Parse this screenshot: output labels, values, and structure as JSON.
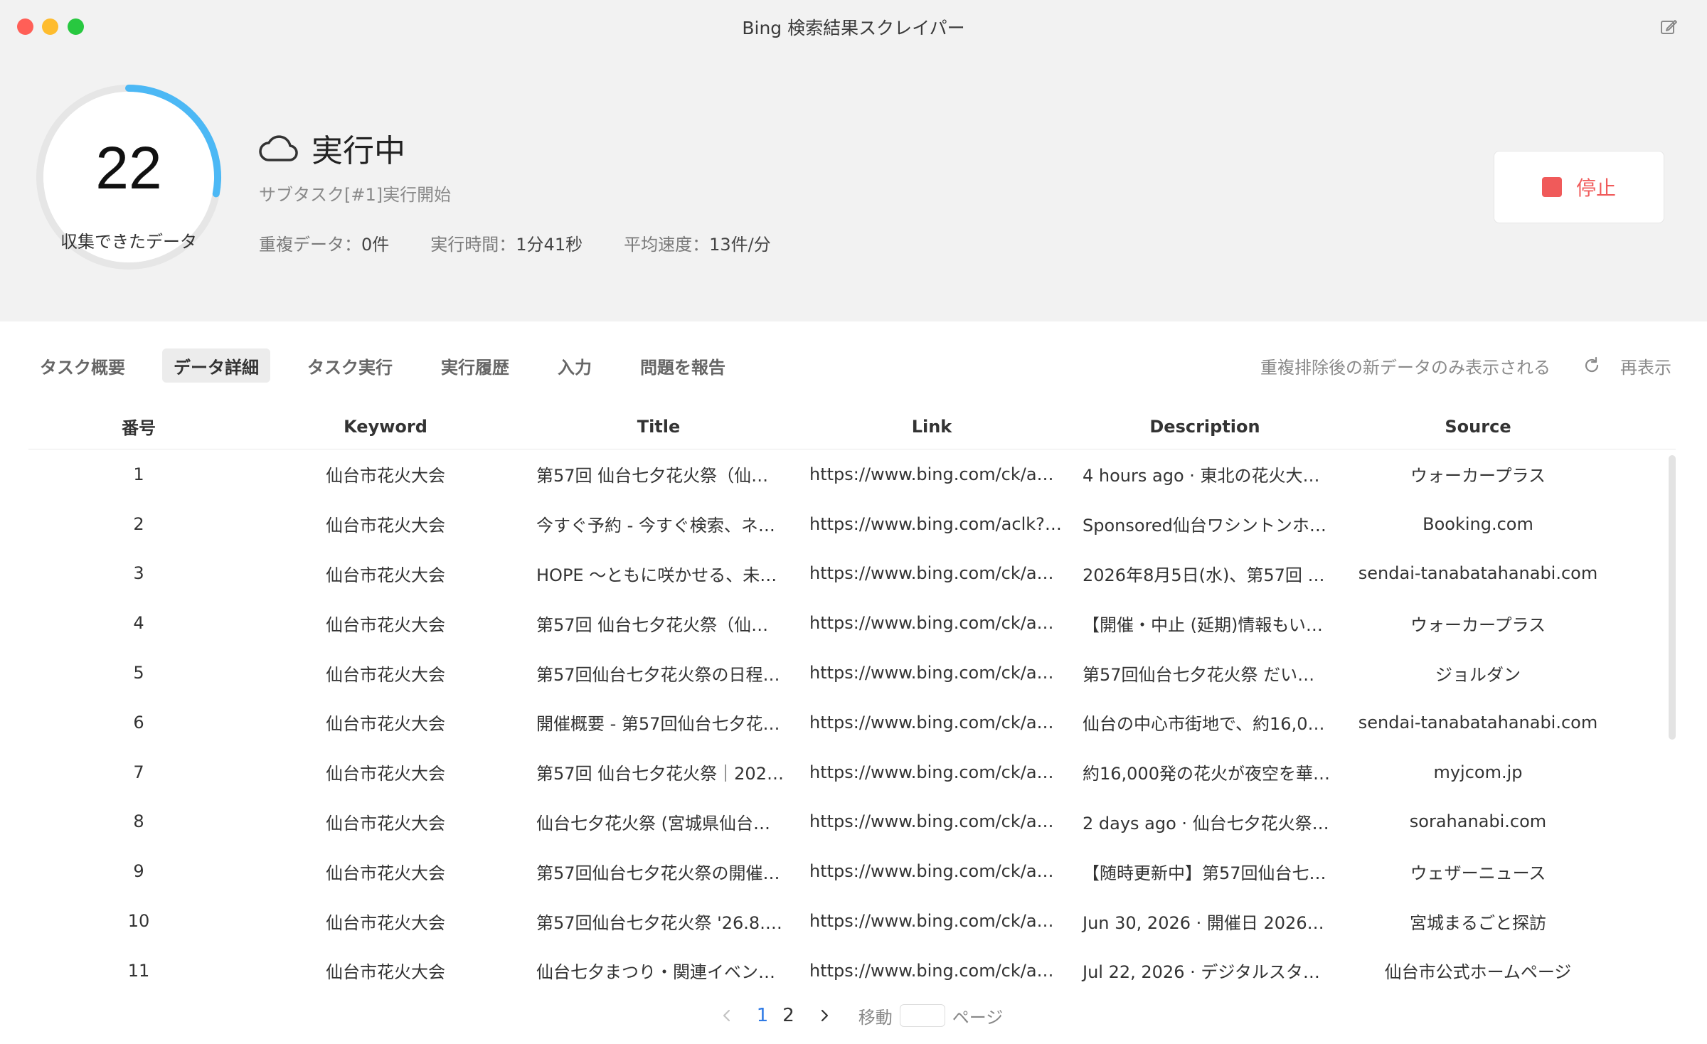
{
  "window": {
    "title": "Bing 検索結果スクレイパー"
  },
  "status": {
    "collected_count": "22",
    "collected_label": "収集できたデータ",
    "progress_fraction": 0.28,
    "state": "実行中",
    "subtask": "サブタスク[#1]実行開始",
    "metrics": [
      {
        "label": "重複データ：",
        "value": "0件"
      },
      {
        "label": "実行時間：",
        "value": "1分41秒"
      },
      {
        "label": "平均速度：",
        "value": "13件/分"
      }
    ],
    "stop_label": "停止",
    "accent_color": "#4cb8f5",
    "stop_color": "#f05a5a"
  },
  "tabs": [
    {
      "label": "タスク概要",
      "active": false
    },
    {
      "label": "データ詳細",
      "active": true
    },
    {
      "label": "タスク実行",
      "active": false
    },
    {
      "label": "実行履歴",
      "active": false
    },
    {
      "label": "入力",
      "active": false
    },
    {
      "label": "問題を報告",
      "active": false
    }
  ],
  "toolbar": {
    "dedupe_note": "重複排除後の新データのみ表示される",
    "refresh_label": "再表示"
  },
  "table": {
    "columns": [
      "番号",
      "Keyword",
      "Title",
      "Link",
      "Description",
      "Source"
    ],
    "rows": [
      [
        "1",
        "仙台市花火大会",
        "第57回 仙台七夕花火祭（仙…",
        "https://www.bing.com/ck/a?!…",
        "4 hours ago · 東北の花火大会…",
        "ウォーカープラス"
      ],
      [
        "2",
        "仙台市花火大会",
        "今すぐ予約 - 今すぐ検索、ネ…",
        "https://www.bing.com/aclk?l…",
        "Sponsored仙台ワシントンホ…",
        "Booking.com"
      ],
      [
        "3",
        "仙台市花火大会",
        "HOPE 〜ともに咲かせる、未…",
        "https://www.bing.com/ck/a?!…",
        "2026年8月5日(水)、第57回 …",
        "sendai-tanabatahanabi.com"
      ],
      [
        "4",
        "仙台市花火大会",
        "第57回 仙台七夕花火祭（仙…",
        "https://www.bing.com/ck/a?!…",
        "【開催・中止 (延期)情報もい…",
        "ウォーカープラス"
      ],
      [
        "5",
        "仙台市花火大会",
        "第57回仙台七夕花火祭の日程…",
        "https://www.bing.com/ck/a?!…",
        "第57回仙台七夕花火祭 だい…",
        "ジョルダン"
      ],
      [
        "6",
        "仙台市花火大会",
        "開催概要 - 第57回仙台七夕花…",
        "https://www.bing.com/ck/a?!…",
        "仙台の中心市街地で、約16,0…",
        "sendai-tanabatahanabi.com"
      ],
      [
        "7",
        "仙台市花火大会",
        "第57回 仙台七夕花火祭｜202…",
        "https://www.bing.com/ck/a?!…",
        "約16,000発の花火が夜空を華…",
        "myjcom.jp"
      ],
      [
        "8",
        "仙台市花火大会",
        "仙台七夕花火祭 (宮城県仙台…",
        "https://www.bing.com/ck/a?!…",
        "2 days ago · 仙台七夕花火祭…",
        "sorahanabi.com"
      ],
      [
        "9",
        "仙台市花火大会",
        "第57回仙台七夕花火祭の開催…",
        "https://www.bing.com/ck/a?!…",
        "【随時更新中】第57回仙台七…",
        "ウェザーニュース"
      ],
      [
        "10",
        "仙台市花火大会",
        "第57回仙台七夕花火祭 '26.8.…",
        "https://www.bing.com/ck/a?!…",
        "Jun 30, 2026 · 開催日 2026…",
        "宮城まるごと探訪"
      ],
      [
        "11",
        "仙台市花火大会",
        "仙台七夕まつり・関連イベン…",
        "https://www.bing.com/ck/a?!…",
        "Jul 22, 2026 · デジタルスタ…",
        "仙台市公式ホームページ"
      ]
    ]
  },
  "pagination": {
    "pages": [
      "1",
      "2"
    ],
    "current": "1",
    "goto_label": "移動",
    "goto_value": "",
    "page_unit": "ページ"
  }
}
